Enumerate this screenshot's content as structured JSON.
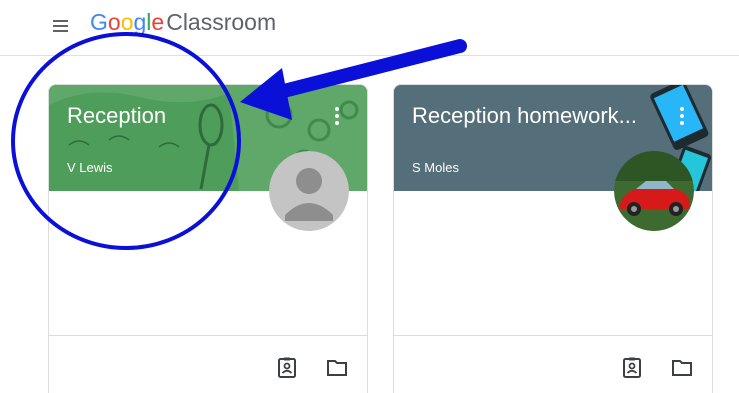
{
  "header": {
    "logo_letters": [
      "G",
      "o",
      "o",
      "g",
      "l",
      "e"
    ],
    "logo_colors": [
      "#4285f4",
      "#ea4335",
      "#fbbc05",
      "#4285f4",
      "#34a853",
      "#ea4335"
    ],
    "product_name": "Classroom",
    "menu_icon": "hamburger-menu-icon"
  },
  "classes": [
    {
      "title": "Reception",
      "teacher": "V Lewis",
      "banner_color": "#5fa86a",
      "avatar": "default-person-avatar",
      "footer_icons": [
        "assignment-ind-icon",
        "folder-icon"
      ]
    },
    {
      "title": "Reception homework...",
      "teacher": "S Moles",
      "banner_color": "#546e7a",
      "avatar": "red-car-photo-avatar",
      "footer_icons": [
        "assignment-ind-icon",
        "folder-icon"
      ]
    }
  ],
  "annotation": {
    "circle_color": "#0a10d8",
    "arrow_color": "#0a10d8"
  }
}
